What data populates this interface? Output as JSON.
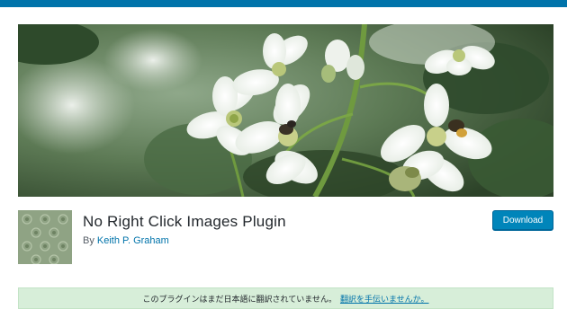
{
  "header": {
    "bar_color": "#0073aa"
  },
  "banner": {
    "image_description": "blackberry-blossom-with-bees",
    "colors": {
      "foliage": "#3d5a37",
      "petal": "#ffffff",
      "stem": "#6f9a3f"
    }
  },
  "plugin": {
    "icon_name": "pattern-tile-icon",
    "title": "No Right Click Images Plugin",
    "by_label": "By",
    "author": "Keith P. Graham",
    "download_label": "Download"
  },
  "notice": {
    "text": "このプラグインはまだ日本語に翻訳されていません。",
    "link_text": "翻訳を手伝いませんか。",
    "background": "#d7eed9"
  },
  "colors": {
    "accent": "#0073aa",
    "button": "#0085ba"
  }
}
